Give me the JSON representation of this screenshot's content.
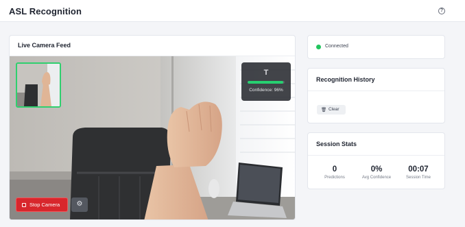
{
  "header": {
    "title": "ASL Recognition",
    "help_icon": "help-circle-icon"
  },
  "camera": {
    "title": "Live Camera Feed",
    "prediction": {
      "letter": "T",
      "confidence_label": "Confidence: 96%",
      "confidence": 0.96
    },
    "stop_button": {
      "label": "Stop Camera",
      "icon": "stop-square-icon"
    },
    "settings_button": {
      "icon": "settings-icon"
    }
  },
  "status": {
    "text": "Connected",
    "color": "#22c55e"
  },
  "history": {
    "title": "Recognition History",
    "clear_label": "Clear",
    "clear_icon": "trash-icon"
  },
  "stats": {
    "title": "Session Stats",
    "items": [
      {
        "value": "0",
        "label": "Predictions"
      },
      {
        "value": "0%",
        "label": "Avg Confidence"
      },
      {
        "value": "00:07",
        "label": "Session Time"
      }
    ]
  },
  "colors": {
    "accent_green": "#27d070",
    "stop_red": "#d8262c"
  }
}
